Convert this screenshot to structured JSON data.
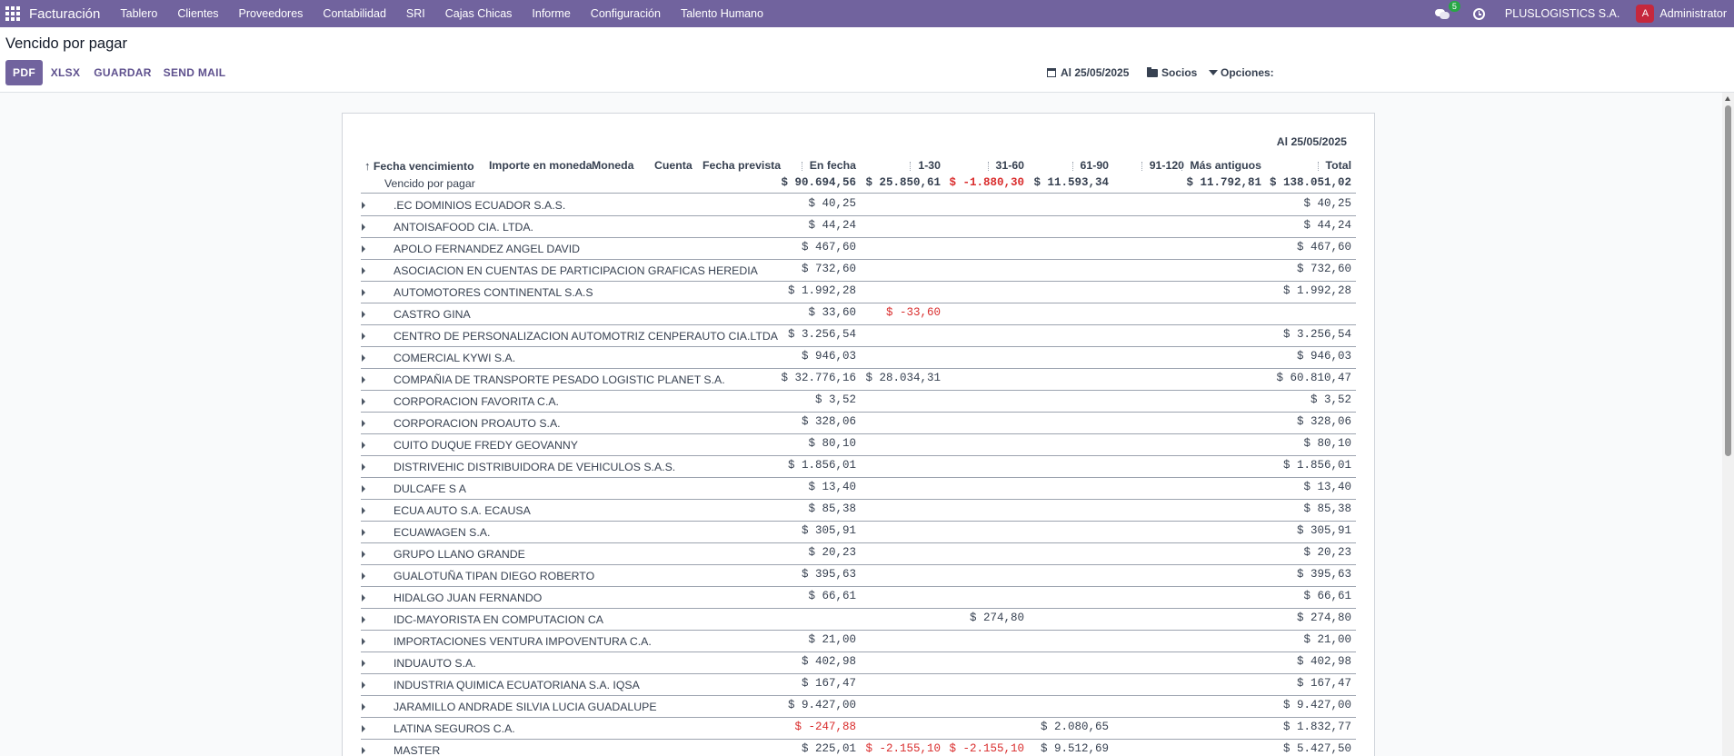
{
  "navbar": {
    "brand": "Facturación",
    "menu": [
      "Tablero",
      "Clientes",
      "Proveedores",
      "Contabilidad",
      "SRI",
      "Cajas Chicas",
      "Informe",
      "Configuración",
      "Talento Humano"
    ],
    "messages_count": "5",
    "company": "PLUSLOGISTICS S.A.",
    "avatar_initial": "A",
    "user": "Administrator"
  },
  "control_panel": {
    "title": "Vencido por pagar",
    "buttons": {
      "pdf": "PDF",
      "xlsx": "XLSX",
      "guardar": "GUARDAR",
      "send_mail": "SEND MAIL"
    },
    "filters": {
      "date": "Al 25/05/2025",
      "partners": "Socios",
      "options": "Opciones:"
    }
  },
  "report": {
    "date_heading": "Al 25/05/2025",
    "columns": {
      "due_date": "Fecha vencimiento",
      "amount_currency": "Importe en moneda",
      "currency": "Moneda",
      "account": "Cuenta",
      "expected_date": "Fecha prevista",
      "on_date": "En fecha",
      "p1_30": "1-30",
      "p31_60": "31-60",
      "p61_90": "61-90",
      "p91_120": "91-120",
      "older": "Más antiguos",
      "total": "Total"
    },
    "total_label": "Vencido por pagar",
    "totals": [
      "$ 90.694,56",
      "$ 25.850,61",
      "$ -1.880,30",
      "$ 11.593,34",
      "",
      "$ 11.792,81",
      "$ 138.051,02"
    ],
    "rows": [
      {
        "name": ".EC DOMINIOS ECUADOR S.A.S.",
        "values": [
          "$ 40,25",
          "",
          "",
          "",
          "",
          "",
          "$ 40,25"
        ]
      },
      {
        "name": "ANTOISAFOOD CIA. LTDA.",
        "values": [
          "$ 44,24",
          "",
          "",
          "",
          "",
          "",
          "$ 44,24"
        ]
      },
      {
        "name": "APOLO FERNANDEZ ANGEL DAVID",
        "values": [
          "$ 467,60",
          "",
          "",
          "",
          "",
          "",
          "$ 467,60"
        ]
      },
      {
        "name": "ASOCIACION EN CUENTAS DE PARTICIPACION GRAFICAS HEREDIA",
        "values": [
          "$ 732,60",
          "",
          "",
          "",
          "",
          "",
          "$ 732,60"
        ]
      },
      {
        "name": "AUTOMOTORES CONTINENTAL S.A.S",
        "values": [
          "$ 1.992,28",
          "",
          "",
          "",
          "",
          "",
          "$ 1.992,28"
        ]
      },
      {
        "name": "CASTRO GINA",
        "values": [
          "$ 33,60",
          "$ -33,60",
          "",
          "",
          "",
          "",
          ""
        ]
      },
      {
        "name": "CENTRO DE PERSONALIZACION AUTOMOTRIZ CENPERAUTO CIA.LTDA",
        "values": [
          "$ 3.256,54",
          "",
          "",
          "",
          "",
          "",
          "$ 3.256,54"
        ]
      },
      {
        "name": "COMERCIAL KYWI S.A.",
        "values": [
          "$ 946,03",
          "",
          "",
          "",
          "",
          "",
          "$ 946,03"
        ]
      },
      {
        "name": "COMPAÑIA DE TRANSPORTE PESADO LOGISTIC PLANET S.A.",
        "values": [
          "$ 32.776,16",
          "$ 28.034,31",
          "",
          "",
          "",
          "",
          "$ 60.810,47"
        ]
      },
      {
        "name": "CORPORACION FAVORITA C.A.",
        "values": [
          "$ 3,52",
          "",
          "",
          "",
          "",
          "",
          "$ 3,52"
        ]
      },
      {
        "name": "CORPORACION PROAUTO S.A.",
        "values": [
          "$ 328,06",
          "",
          "",
          "",
          "",
          "",
          "$ 328,06"
        ]
      },
      {
        "name": "CUITO DUQUE FREDY GEOVANNY",
        "values": [
          "$ 80,10",
          "",
          "",
          "",
          "",
          "",
          "$ 80,10"
        ]
      },
      {
        "name": "DISTRIVEHIC DISTRIBUIDORA DE VEHICULOS S.A.S.",
        "values": [
          "$ 1.856,01",
          "",
          "",
          "",
          "",
          "",
          "$ 1.856,01"
        ]
      },
      {
        "name": "DULCAFE S A",
        "values": [
          "$ 13,40",
          "",
          "",
          "",
          "",
          "",
          "$ 13,40"
        ]
      },
      {
        "name": "ECUA AUTO S.A. ECAUSA",
        "values": [
          "$ 85,38",
          "",
          "",
          "",
          "",
          "",
          "$ 85,38"
        ]
      },
      {
        "name": "ECUAWAGEN S.A.",
        "values": [
          "$ 305,91",
          "",
          "",
          "",
          "",
          "",
          "$ 305,91"
        ]
      },
      {
        "name": "GRUPO LLANO GRANDE",
        "values": [
          "$ 20,23",
          "",
          "",
          "",
          "",
          "",
          "$ 20,23"
        ]
      },
      {
        "name": "GUALOTUÑA TIPAN DIEGO ROBERTO",
        "values": [
          "$ 395,63",
          "",
          "",
          "",
          "",
          "",
          "$ 395,63"
        ]
      },
      {
        "name": "HIDALGO JUAN FERNANDO",
        "values": [
          "$ 66,61",
          "",
          "",
          "",
          "",
          "",
          "$ 66,61"
        ]
      },
      {
        "name": "IDC-MAYORISTA EN COMPUTACION CA",
        "values": [
          "",
          "",
          "$ 274,80",
          "",
          "",
          "",
          "$ 274,80"
        ]
      },
      {
        "name": "IMPORTACIONES VENTURA IMPOVENTURA C.A.",
        "values": [
          "$ 21,00",
          "",
          "",
          "",
          "",
          "",
          "$ 21,00"
        ]
      },
      {
        "name": "INDUAUTO S.A.",
        "values": [
          "$ 402,98",
          "",
          "",
          "",
          "",
          "",
          "$ 402,98"
        ]
      },
      {
        "name": "INDUSTRIA QUIMICA ECUATORIANA S.A. IQSA",
        "values": [
          "$ 167,47",
          "",
          "",
          "",
          "",
          "",
          "$ 167,47"
        ]
      },
      {
        "name": "JARAMILLO ANDRADE SILVIA LUCIA GUADALUPE",
        "values": [
          "$ 9.427,00",
          "",
          "",
          "",
          "",
          "",
          "$ 9.427,00"
        ]
      },
      {
        "name": "LATINA SEGUROS C.A.",
        "values": [
          "$ -247,88",
          "",
          "",
          "$ 2.080,65",
          "",
          "",
          "$ 1.832,77"
        ]
      },
      {
        "name": "MASTER",
        "values": [
          "$ 225,01",
          "$ -2.155,10",
          "$ -2.155,10",
          "$ 9.512,69",
          "",
          "",
          "$ 5.427,50"
        ]
      }
    ]
  },
  "colors": {
    "navbar": "#71639e",
    "negative": "#d92c2c",
    "primary_button": "#71639e"
  }
}
